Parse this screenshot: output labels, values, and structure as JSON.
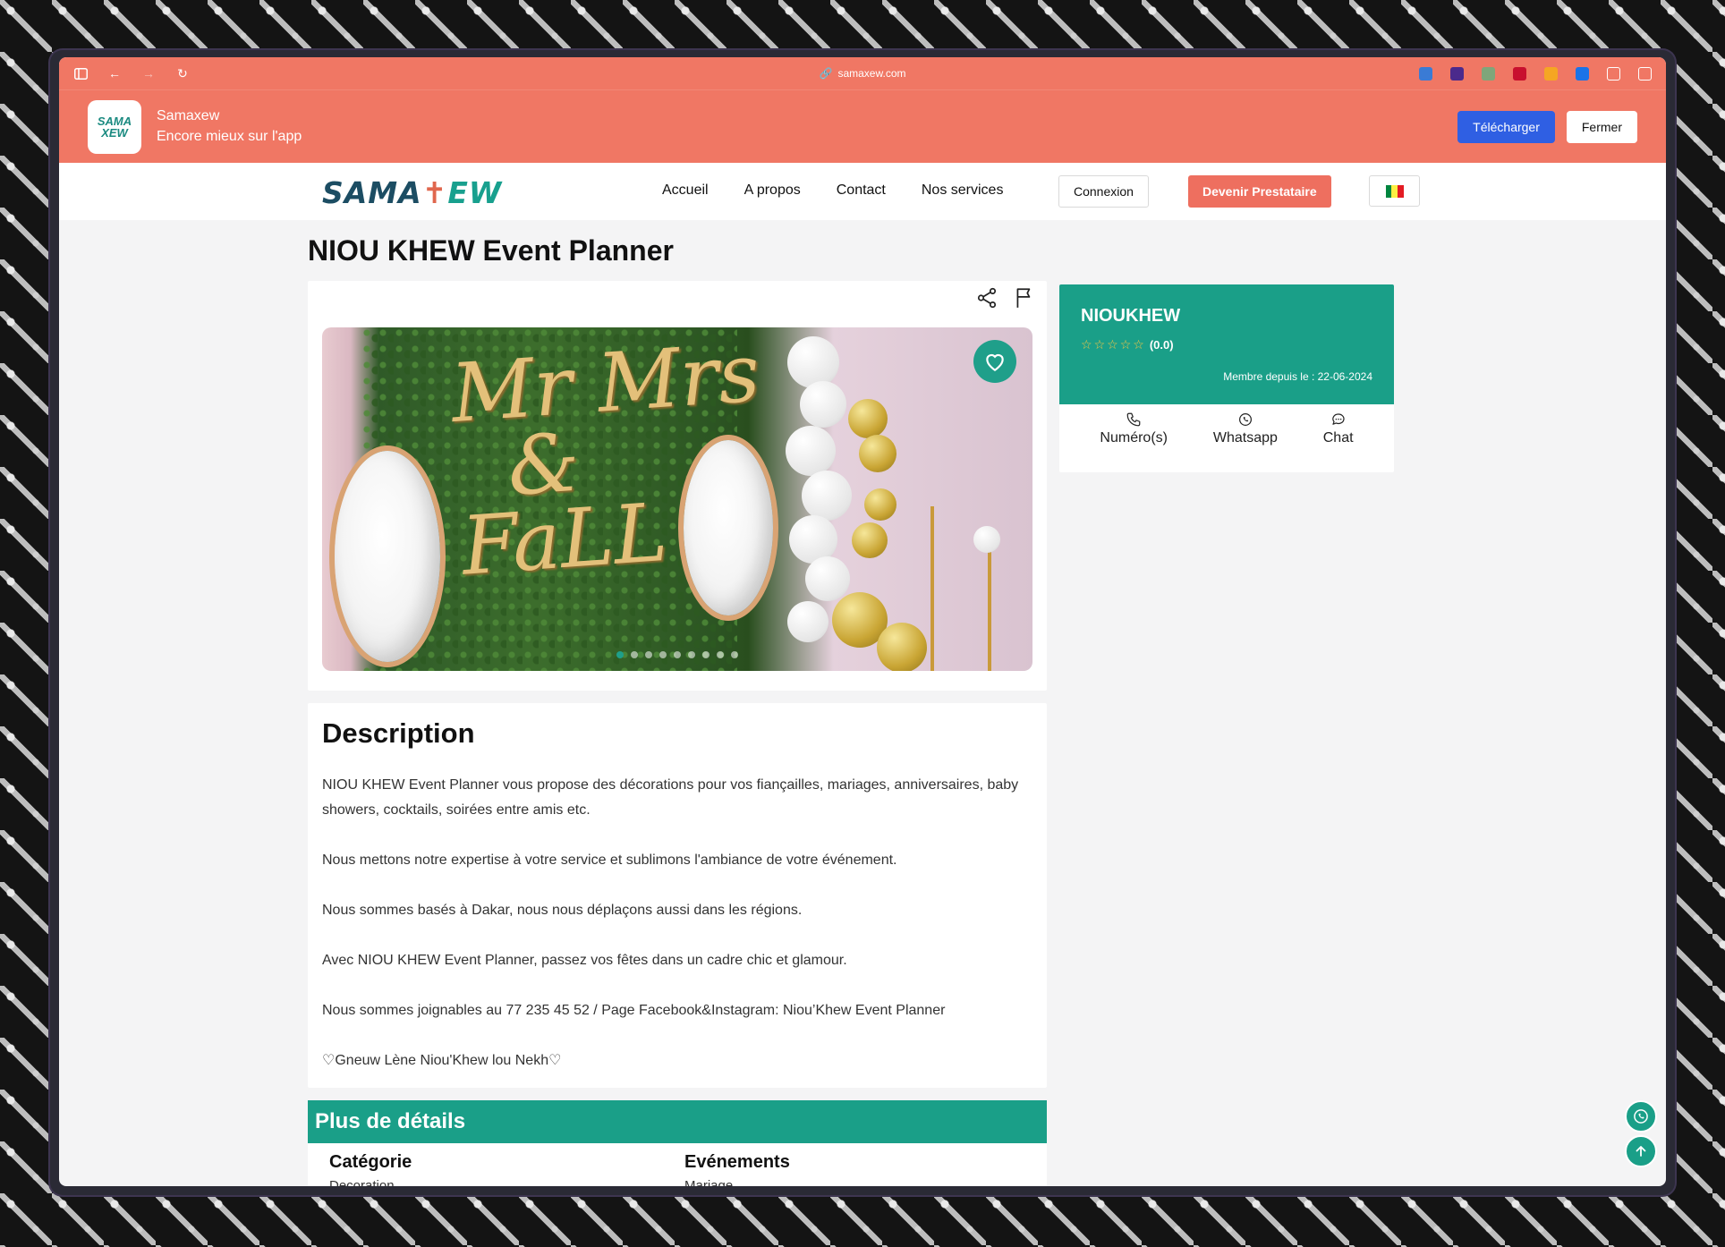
{
  "browser": {
    "url": "samaxew.com"
  },
  "app_banner": {
    "name": "Samaxew",
    "tagline": "Encore mieux sur l'app",
    "logo_text": "SAMA\nXEW",
    "download_label": "Télécharger",
    "close_label": "Fermer"
  },
  "nav": {
    "brand_part1": "SAMA",
    "brand_part2": "EW",
    "links": [
      "Accueil",
      "A propos",
      "Contact",
      "Nos services"
    ],
    "login_label": "Connexion",
    "become_provider_label": "Devenir Prestataire",
    "flag_colors": [
      "#00853f",
      "#fdef42",
      "#e31b23"
    ]
  },
  "page": {
    "title": "NIOU KHEW Event Planner"
  },
  "gallery": {
    "photo_text": "Mr Mrs\n&\nFaLL",
    "slide_count": 9,
    "active_slide": 1
  },
  "seller": {
    "name": "NIOUKHEW",
    "rating_label": "(0.0)",
    "stars": 5,
    "member_since": "Membre depuis le : 22-06-2024",
    "actions": [
      "Numéro(s)",
      "Whatsapp",
      "Chat"
    ]
  },
  "description": {
    "heading": "Description",
    "paragraphs": [
      "NIOU KHEW Event Planner vous propose des décorations pour vos fiançailles, mariages, anniversaires, baby showers, cocktails, soirées entre amis etc.",
      "Nous mettons notre expertise à votre service et sublimons l'ambiance de votre événement.",
      "Nous sommes basés à Dakar, nous nous déplaçons aussi dans les régions.",
      "Avec NIOU KHEW Event Planner, passez vos fêtes dans un cadre chic et glamour.",
      "Nous sommes joignables au 77 235 45 52 / Page Facebook&Instagram: Niou’Khew Event Planner",
      "♡Gneuw Lène Niou'Khew lou Nekh♡"
    ]
  },
  "details": {
    "heading": "Plus de détails",
    "category_label": "Catégorie",
    "category_value": "Decoration",
    "events_label": "Evénements",
    "events_value": "Mariage"
  },
  "colors": {
    "coral": "#f07764",
    "teal": "#1a9f88",
    "blue": "#2f5fe3"
  }
}
